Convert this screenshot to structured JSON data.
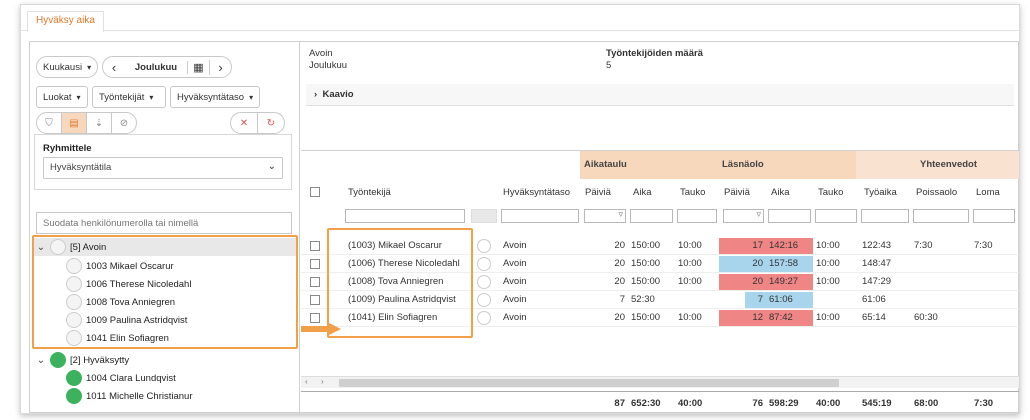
{
  "tab": "Hyväksy aika",
  "toolbar": {
    "period": "Kuukausi",
    "month": "Joulukuu",
    "classes": "Luokat",
    "employees": "Työntekijät",
    "level": "Hyväksyntätaso"
  },
  "group": {
    "label": "Ryhmittele",
    "value": "Hyväksyntätila"
  },
  "search_placeholder": "Suodata henkilönumerolla tai nimellä",
  "tree": {
    "group1": {
      "label": "[5] Avoin",
      "items": [
        "1003 Mikael Oscarur",
        "1006 Therese Nicoledahl",
        "1008 Tova Anniegren",
        "1009 Paulina Astridqvist",
        "1041 Elin Sofiagren"
      ]
    },
    "group2": {
      "label": "[2] Hyväksytty",
      "items": [
        "1004 Clara Lundqvist",
        "1011 Michelle Christianur"
      ]
    }
  },
  "info": {
    "status": "Avoin",
    "month": "Joulukuu",
    "count_label": "Työntekijöiden määrä",
    "count": "5"
  },
  "kaavio": "Kaavio",
  "groups": {
    "schedule": "Aikataulu",
    "presence": "Läsnäolo",
    "summary": "Yhteenvedot"
  },
  "columns": [
    "Työntekijä",
    "Hyväksyntätaso",
    "Päiviä",
    "Aika",
    "Tauko",
    "Päiviä",
    "Aika",
    "Tauko",
    "Työaika",
    "Poissaolo",
    "Loma"
  ],
  "rows": [
    [
      "(1003) Mikael Oscarur",
      "Avoin",
      "20",
      "150:00",
      "10:00",
      "17",
      "142:16",
      "10:00",
      "122:43",
      "7:30",
      "7:30"
    ],
    [
      "(1006) Therese Nicoledahl",
      "Avoin",
      "20",
      "150:00",
      "10:00",
      "20",
      "157:58",
      "10:00",
      "148:47",
      "",
      ""
    ],
    [
      "(1008) Tova Anniegren",
      "Avoin",
      "20",
      "150:00",
      "10:00",
      "20",
      "149:27",
      "10:00",
      "147:29",
      "",
      ""
    ],
    [
      "(1009) Paulina Astridqvist",
      "Avoin",
      "7",
      "52:30",
      "",
      "7",
      "61:06",
      "",
      "61:06",
      "",
      ""
    ],
    [
      "(1041) Elin Sofiagren",
      "Avoin",
      "20",
      "150:00",
      "10:00",
      "12",
      "87:42",
      "10:00",
      "65:14",
      "60:30",
      ""
    ]
  ],
  "totals": [
    "87",
    "652:30",
    "40:00",
    "76",
    "598:29",
    "40:00",
    "545:19",
    "68:00",
    "7:30"
  ],
  "colors": {
    "accent": "#e0792a",
    "group_header": "#f7d8bd",
    "over": "#ef8585",
    "under": "#a8d5ec",
    "approved": "#3cb25f",
    "highlight": "#f29f4a"
  }
}
